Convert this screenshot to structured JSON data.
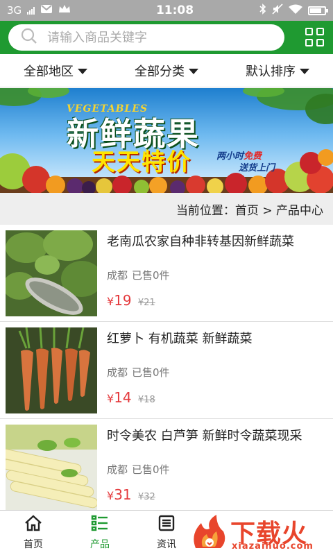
{
  "status_bar": {
    "network": "3G",
    "time": "11:08"
  },
  "header": {
    "search_placeholder": "请输入商品关键字"
  },
  "filters": [
    {
      "label": "全部地区"
    },
    {
      "label": "全部分类"
    },
    {
      "label": "默认排序"
    }
  ],
  "banner": {
    "english": "VEGETABLES",
    "title": "新鲜蔬果",
    "subtitle": "天天特价",
    "tag_line1_a": "两小时",
    "tag_line1_b": "免费",
    "tag_line2": "送货上门"
  },
  "breadcrumb": {
    "text": "当前位置：首页 > 产品中心"
  },
  "products": [
    {
      "title": "老南瓜农家自种非转基因新鲜蔬菜",
      "location": "成都",
      "sold": "已售0件",
      "currency": "¥",
      "price": "19",
      "old_price": "¥21"
    },
    {
      "title": "红萝卜 有机蔬菜 新鲜蔬菜",
      "location": "成都",
      "sold": "已售0件",
      "currency": "¥",
      "price": "14",
      "old_price": "¥18"
    },
    {
      "title": "时令美农 白芦笋 新鲜时令蔬菜现采",
      "location": "成都",
      "sold": "已售0件",
      "currency": "¥",
      "price": "31",
      "old_price": "¥32"
    }
  ],
  "bottom_nav": [
    {
      "label": "首页",
      "icon": "home-icon"
    },
    {
      "label": "产品",
      "icon": "list-icon"
    },
    {
      "label": "资讯",
      "icon": "news-icon"
    }
  ],
  "watermark": {
    "text": "下载火",
    "url": "xiazaihuo.com"
  },
  "colors": {
    "brand_green": "#1f9a31",
    "price_red": "#e4393c",
    "status_gray": "#a9a9a9"
  }
}
